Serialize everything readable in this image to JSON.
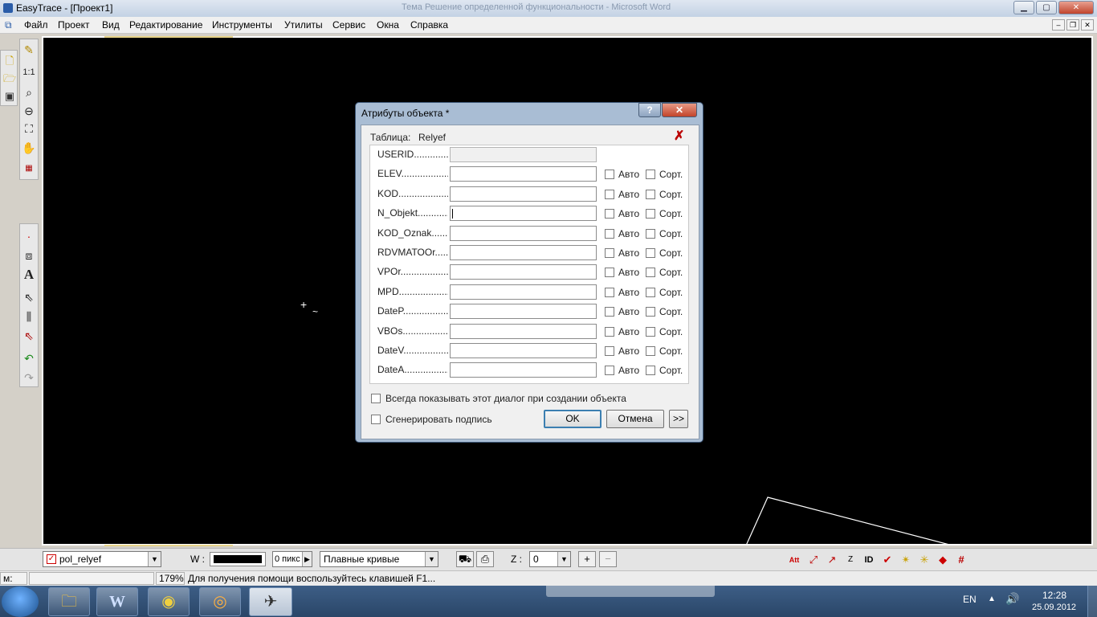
{
  "window": {
    "title": "EasyTrace - [Проект1]",
    "bg_title": "Тема Решение определенной функциональности - Microsoft Word"
  },
  "menu": [
    "Файл",
    "Проект",
    "Вид",
    "Редактирование",
    "Инструменты",
    "Утилиты",
    "Сервис",
    "Окна",
    "Справка"
  ],
  "left_toolbar": {
    "scale_label": "1:1"
  },
  "bottom_toolbar": {
    "layer": "pol_relyef",
    "w_label": "W :",
    "pix_value": "0 пикс",
    "curve_mode": "Плавные кривые",
    "z_label": "Z :",
    "z_value": "0",
    "plus": "+",
    "minus": "−",
    "right_icons": [
      "attribute-icon",
      "node-check-icon",
      "direction-arrow-icon",
      "z-id-icon",
      "id-icon",
      "validate-icon",
      "sparkle-icon",
      "sparkle-small-icon",
      "marker-icon",
      "grid-icon"
    ],
    "id_label": "ID"
  },
  "status": {
    "mode": "м:",
    "zoom": "179%",
    "hint": "Для получения помощи воспользуйтесь клавишей F1..."
  },
  "taskbar": {
    "lang": "EN",
    "time": "12:28",
    "date": "25.09.2012",
    "apps": [
      "explorer-icon",
      "word-icon",
      "money-icon",
      "media-icon",
      "easytrace-icon"
    ],
    "word_letter": "W"
  },
  "dialog": {
    "title": "Атрибуты объекта *",
    "help_btn": "?",
    "close_btn": "✕",
    "table_label": "Таблица:",
    "table_name": "Relyef",
    "fields": [
      {
        "label": "USERID..............",
        "readonly": true
      },
      {
        "label": "ELEV...................",
        "readonly": false
      },
      {
        "label": "KOD....................",
        "readonly": false
      },
      {
        "label": "N_Objekt.............",
        "readonly": false
      },
      {
        "label": "KOD_Oznak..........",
        "readonly": false
      },
      {
        "label": "RDVMATOOr..........",
        "readonly": false
      },
      {
        "label": "VPOr......................",
        "readonly": false
      },
      {
        "label": "MPD.....................",
        "readonly": false
      },
      {
        "label": "DateP....................",
        "readonly": false
      },
      {
        "label": "VBOs.....................",
        "readonly": false
      },
      {
        "label": "DateV....................",
        "readonly": false
      },
      {
        "label": "DateA....................",
        "readonly": false
      }
    ],
    "auto_label": "Авто",
    "sort_label": "Сорт.",
    "always_show": "Всегда показывать этот диалог при создании объекта",
    "generate_caption": "Сгенерировать подпись",
    "ok": "OK",
    "cancel": "Отмена",
    "more": ">>"
  }
}
